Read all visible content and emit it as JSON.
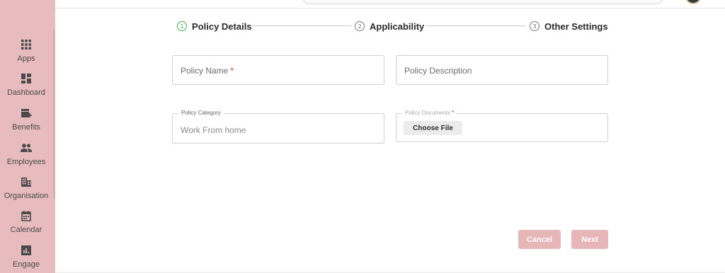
{
  "sidebar": {
    "background": "#e8bcbe",
    "items": [
      {
        "label": "Apps",
        "icon": "apps-grid-icon"
      },
      {
        "label": "Dashboard",
        "icon": "dashboard-icon"
      },
      {
        "label": "Benefits",
        "icon": "benefits-icon"
      },
      {
        "label": "Employees",
        "icon": "employees-icon"
      },
      {
        "label": "Organisation",
        "icon": "organisation-icon"
      },
      {
        "label": "Calendar",
        "icon": "calendar-icon"
      },
      {
        "label": "Engage",
        "icon": "engage-icon"
      }
    ]
  },
  "stepper": {
    "steps": [
      {
        "number": "1",
        "label": "Policy Details",
        "active": true
      },
      {
        "number": "2",
        "label": "Applicability",
        "active": false
      },
      {
        "number": "3",
        "label": "Other Settings",
        "active": false
      }
    ],
    "active_color": "#3fae5a"
  },
  "form": {
    "policy_name": {
      "placeholder": "Policy Name",
      "required_mark": "*"
    },
    "policy_description": {
      "placeholder": "Policy Description"
    },
    "policy_category": {
      "label": "Policy Category",
      "value": "Work From home"
    },
    "policy_documents": {
      "label": "Policy Documents",
      "required_mark": "*",
      "button_label": "Choose File"
    }
  },
  "actions": {
    "cancel_label": "Cancel",
    "next_label": "Next",
    "button_color": "#e7b6b8"
  }
}
